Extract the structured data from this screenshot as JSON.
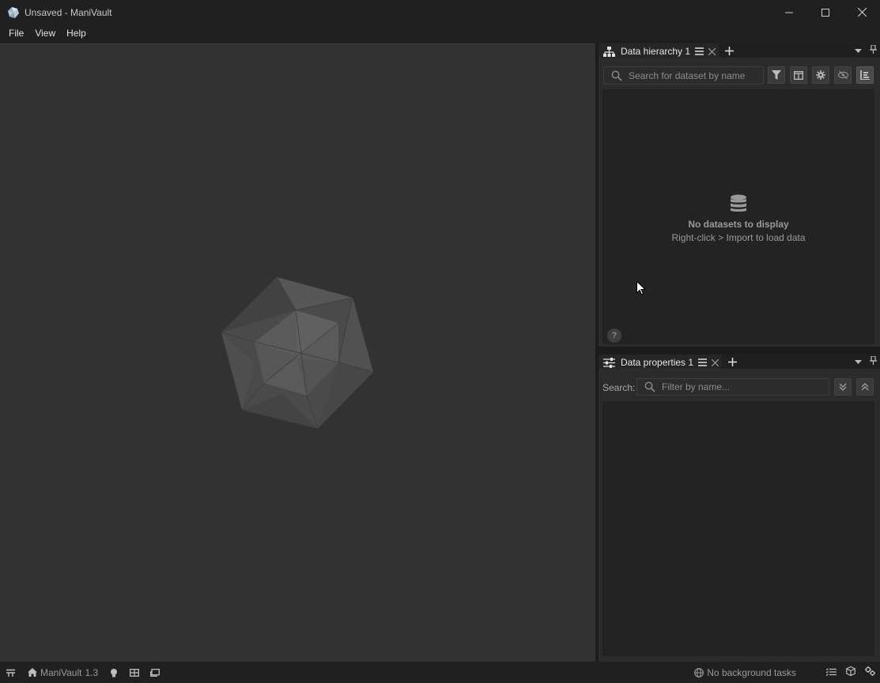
{
  "window": {
    "title": "Unsaved - ManiVault",
    "minimize_icon": "minimize-icon",
    "maximize_icon": "maximize-icon",
    "close_icon": "close-icon"
  },
  "menubar": {
    "items": [
      {
        "label": "File"
      },
      {
        "label": "View"
      },
      {
        "label": "Help"
      }
    ]
  },
  "viewer": {
    "logo_icon": "icosahedron-logo"
  },
  "data_hierarchy": {
    "tab_label": "Data hierarchy 1",
    "search_placeholder": "Search for dataset by name",
    "toolbar_icons": [
      "filter-icon",
      "columns-icon",
      "settings-icon",
      "hidden-icon",
      "expand-icon"
    ],
    "empty_title": "No datasets to display",
    "empty_subtitle": "Right-click > Import to load data",
    "help_label": "?"
  },
  "data_properties": {
    "tab_label": "Data properties 1",
    "search_label": "Search:",
    "search_placeholder": "Filter by name...",
    "toolbar_icons": [
      "expand-all-icon",
      "collapse-all-icon"
    ]
  },
  "statusbar": {
    "app_name": "ManiVault",
    "version": "1.3",
    "background_tasks": "No background tasks"
  },
  "colors": {
    "background": "#202020",
    "viewer": "#323232",
    "panel": "#2b2b2b",
    "text": "#dcdcdc",
    "muted": "#9a9a9a"
  }
}
